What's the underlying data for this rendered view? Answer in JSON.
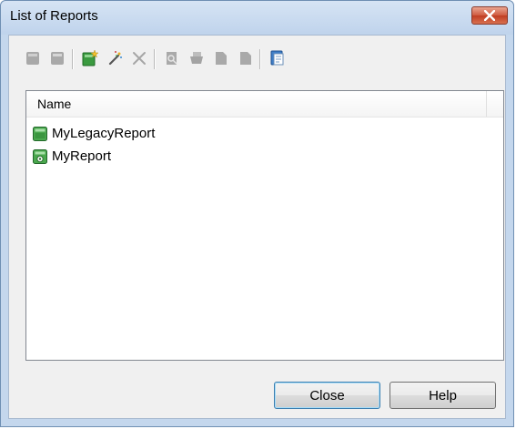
{
  "window": {
    "title": "List of Reports"
  },
  "toolbar": {
    "buttons": [
      {
        "name": "properties-icon",
        "enabled": false
      },
      {
        "name": "folder-properties-icon",
        "enabled": false
      },
      {
        "name": "new-report-icon",
        "enabled": true
      },
      {
        "name": "report-wizard-icon",
        "enabled": true
      },
      {
        "name": "delete-icon",
        "enabled": false
      },
      {
        "name": "preview-icon",
        "enabled": false
      },
      {
        "name": "print-icon",
        "enabled": false
      },
      {
        "name": "generate-rtf-icon",
        "enabled": false
      },
      {
        "name": "generate-html-icon",
        "enabled": false
      },
      {
        "name": "report-template-icon",
        "enabled": true
      }
    ]
  },
  "list": {
    "column_name": "Name",
    "items": [
      {
        "label": "MyLegacyReport",
        "icon": "legacy-report-icon"
      },
      {
        "label": "MyReport",
        "icon": "report-icon"
      }
    ]
  },
  "buttons": {
    "close": "Close",
    "help": "Help"
  }
}
